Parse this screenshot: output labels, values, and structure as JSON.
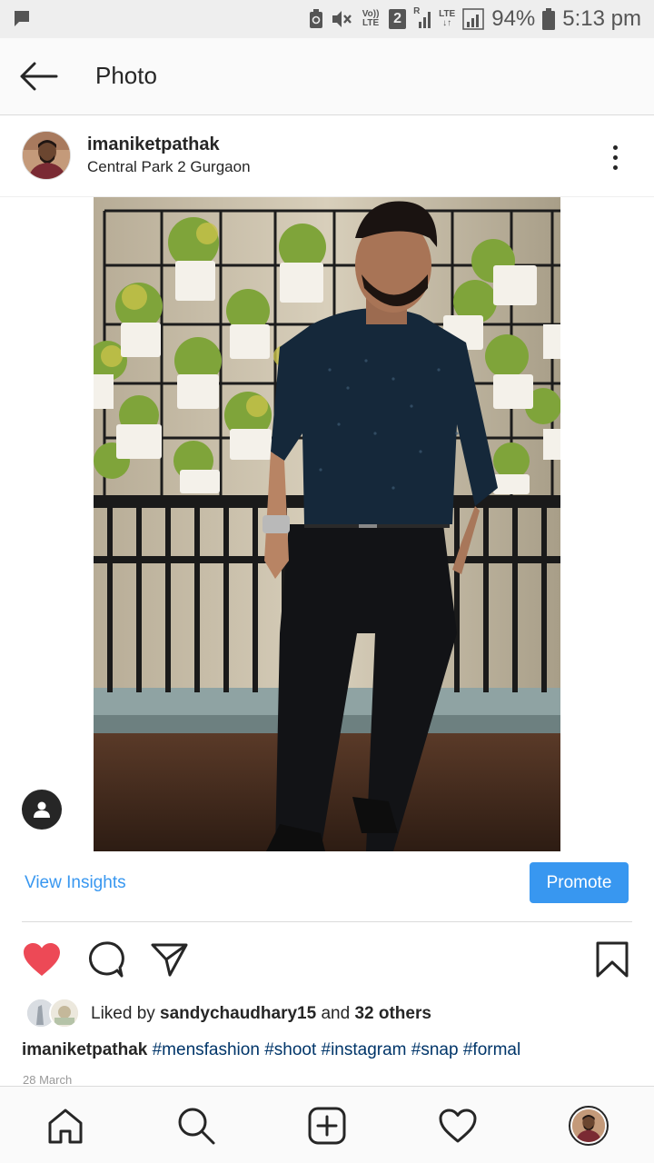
{
  "status_bar": {
    "volte": "Vo)) LTE",
    "sim_number": "2",
    "roaming": "R",
    "lte": "LTE",
    "battery": "94%",
    "time": "5:13 pm"
  },
  "header": {
    "title": "Photo"
  },
  "post": {
    "username": "imaniketpathak",
    "location": "Central Park 2 Gurgaon"
  },
  "insights": {
    "view_label": "View Insights",
    "promote_label": "Promote"
  },
  "likes": {
    "prefix": "Liked by ",
    "liker": "sandychaudhary15",
    "middle": " and ",
    "others": "32 others"
  },
  "caption": {
    "username": "imaniketpathak",
    "hashtags": [
      "#mensfashion",
      "#shoot",
      "#instagram",
      "#snap",
      "#formal"
    ]
  },
  "date": "28 March",
  "colors": {
    "accent": "#3897f0",
    "like": "#ed4956",
    "hashtag": "#003569"
  },
  "icons": {
    "back": "arrow-left-icon",
    "more": "more-vertical-icon",
    "tag": "person-tag-icon",
    "like": "heart-filled-icon",
    "comment": "comment-icon",
    "share": "paper-plane-icon",
    "save": "bookmark-icon",
    "home": "home-icon",
    "search": "search-icon",
    "new_post": "plus-square-icon",
    "activity": "heart-outline-icon"
  }
}
